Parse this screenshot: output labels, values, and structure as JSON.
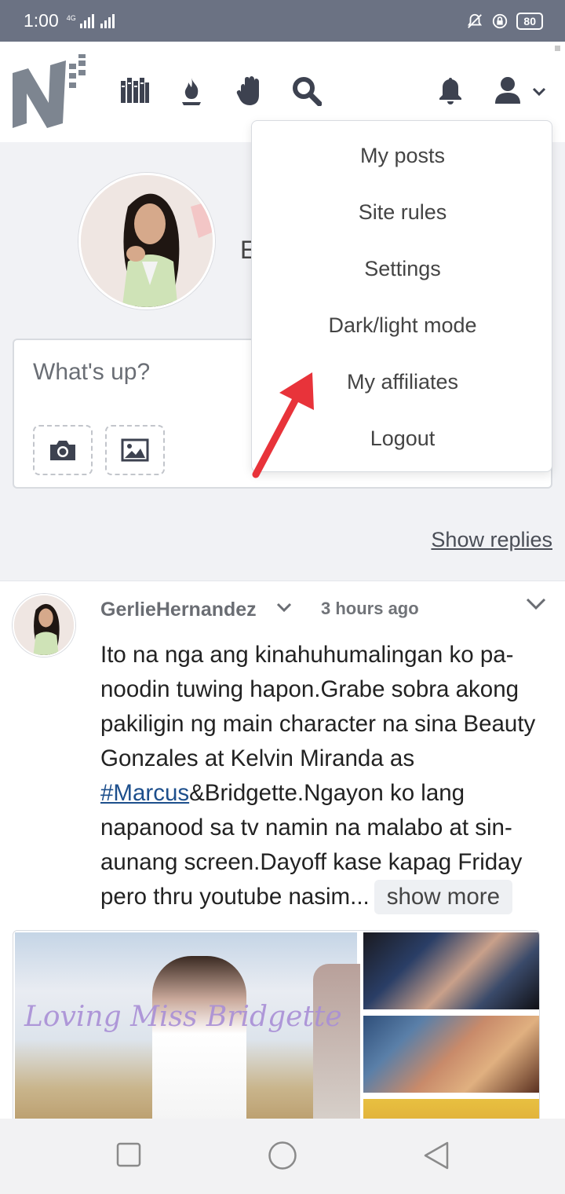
{
  "status_bar": {
    "time": "1:00",
    "network": "4G",
    "battery": "80"
  },
  "header": {
    "nav_icons": [
      "library-icon",
      "flame-icon",
      "hand-icon",
      "search-icon"
    ],
    "notification_icon": "bell-icon",
    "profile_icon": "user-icon"
  },
  "profile": {
    "name_partial": "E"
  },
  "composer": {
    "placeholder": "What's up?"
  },
  "show_replies": "Show replies",
  "dropdown": {
    "items": [
      "My posts",
      "Site rules",
      "Settings",
      "Dark/light mode",
      "My affiliates",
      "Logout"
    ]
  },
  "post": {
    "author": "GerlieHernandez",
    "time": "3 hours ago",
    "text_before": "Ito na nga ang kinahuhumalingan ko pa-noodin tuwing hapon.Grabe sobra akong pakiligin ng main character na sina Beauty Gonzales at Kelvin Miranda as ",
    "hashtag": "#Marcus",
    "text_after": "&Bridgette.Ngayon ko lang napanood sa tv namin na malabo at sin-aunang screen.Dayoff kase kapag Friday pero thru youtube nasim...",
    "show_more": "show more",
    "image_caption": "Loving Miss Bridgette"
  },
  "colors": {
    "status_bar": "#6b7283",
    "accent_link": "#1d4f8c",
    "arrow": "#e8333a",
    "background": "#f1f2f5"
  }
}
